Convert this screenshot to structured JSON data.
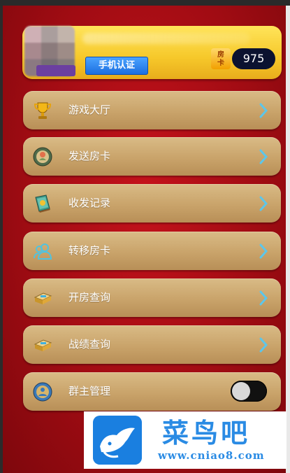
{
  "header": {
    "verify_button": "手机认证",
    "card_label": "房\n卡",
    "card_count": "975"
  },
  "menu": [
    {
      "label": "游戏大厅",
      "icon": "trophy-icon"
    },
    {
      "label": "发送房卡",
      "icon": "send-card-icon"
    },
    {
      "label": "收发记录",
      "icon": "record-book-icon"
    },
    {
      "label": "转移房卡",
      "icon": "users-transfer-icon"
    },
    {
      "label": "开房查询",
      "icon": "room-query-icon"
    },
    {
      "label": "战绩查询",
      "icon": "score-query-icon"
    },
    {
      "label": "群主管理",
      "icon": "group-admin-icon"
    }
  ],
  "group_admin_toggle": {
    "on": false
  },
  "watermark": {
    "title": "菜鸟吧",
    "url": "www.cniao8.com"
  },
  "colors": {
    "background": "#a10c13",
    "row": "#c9a36a",
    "header": "#f6c82a",
    "verify_button": "#1b6ee0",
    "chevron": "#5cc6ea",
    "watermark_blue": "#2a8be4"
  }
}
